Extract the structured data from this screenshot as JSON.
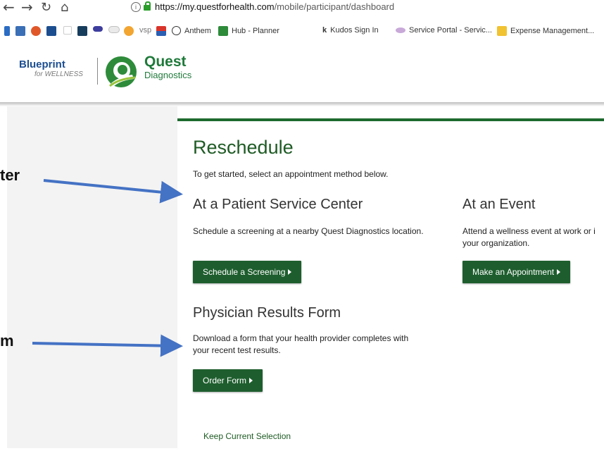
{
  "browser": {
    "url_host": "https://my.questforhealth.com",
    "url_path": "/mobile/participant/dashboard",
    "bookmarks": [
      "vsp",
      "Anthem",
      "Hub - Planner",
      "Kudos Sign In",
      "Service Portal - Servic...",
      "Expense Management..."
    ]
  },
  "header": {
    "blueprint_title": "Blueprint",
    "blueprint_sub": "for WELLNESS",
    "quest_title": "Quest",
    "quest_sub": "Diagnostics"
  },
  "card": {
    "title": "Reschedule",
    "subtitle": "To get started, select an appointment method below.",
    "patient": {
      "heading": "At a Patient Service Center",
      "desc": "Schedule a screening at a nearby Quest Diagnostics location.",
      "button": "Schedule a Screening"
    },
    "event": {
      "heading": "At an Event",
      "desc_line1": "Attend a wellness event at work or i",
      "desc_line2": "your organization.",
      "button": "Make an Appointment"
    },
    "physician": {
      "heading": "Physician Results Form",
      "desc_line1": "Download a form that your health provider completes with",
      "desc_line2": "your recent test results.",
      "button": "Order Form"
    },
    "keep_link": "Keep Current Selection"
  },
  "annotations": {
    "label1": "ter",
    "label2": "m"
  },
  "colors": {
    "brand_green": "#1e5e2e",
    "arrow_blue": "#4472c4"
  }
}
